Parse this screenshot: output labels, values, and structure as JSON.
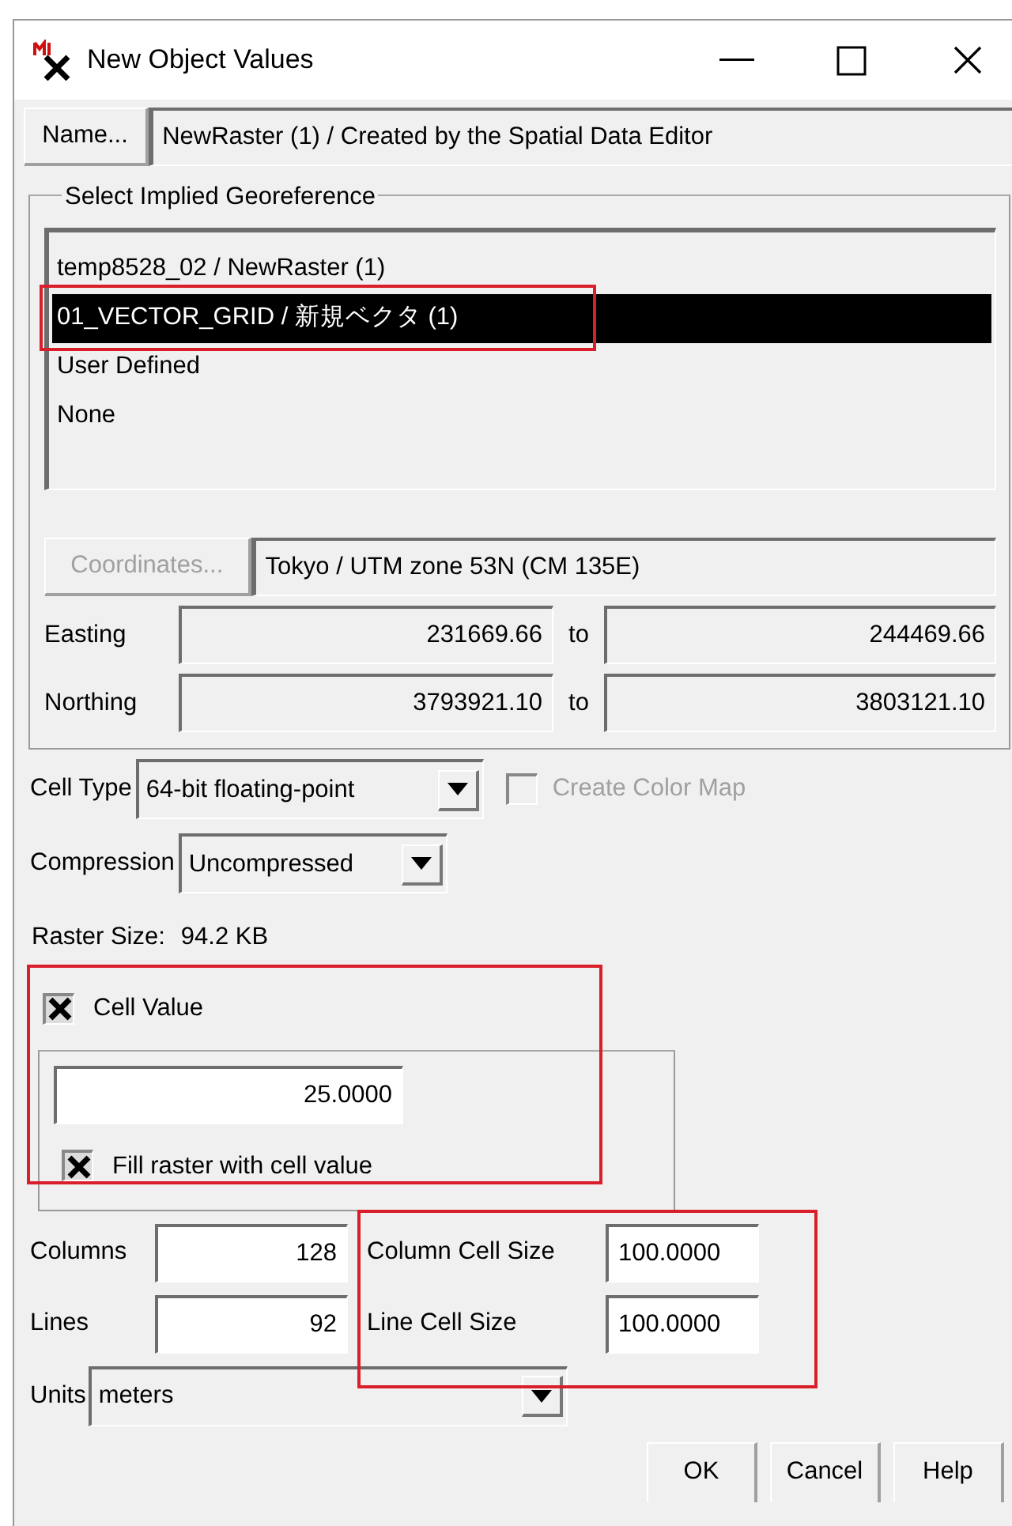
{
  "window": {
    "title": "New Object Values"
  },
  "name_button": {
    "label": "Name..."
  },
  "name_value": "NewRaster (1) / Created by the Spatial Data Editor",
  "georeference": {
    "legend": "Select Implied Georeference",
    "items": [
      {
        "label": "temp8528_02 / NewRaster (1)",
        "selected": false,
        "highlighted": false
      },
      {
        "label": "01_VECTOR_GRID / 新規ベクタ (1)",
        "selected": true,
        "highlighted": true
      },
      {
        "label": "User Defined",
        "selected": false,
        "highlighted": false
      },
      {
        "label": "None",
        "selected": false,
        "highlighted": false
      }
    ],
    "coordinates_button": {
      "label": "Coordinates...",
      "disabled": true
    },
    "coordinate_system": "Tokyo / UTM zone 53N (CM 135E)",
    "ranges": [
      {
        "label": "Easting",
        "from": "231669.66",
        "to_label": "to",
        "to": "244469.66"
      },
      {
        "label": "Northing",
        "from": "3793921.10",
        "to_label": "to",
        "to": "3803121.10"
      }
    ]
  },
  "cell_type": {
    "label": "Cell Type",
    "value": "64-bit floating-point"
  },
  "create_color_map": {
    "label": "Create Color Map",
    "checked": false,
    "disabled": true
  },
  "compression": {
    "label": "Compression",
    "value": "Uncompressed"
  },
  "raster_size": {
    "label": "Raster Size:",
    "value": "94.2 KB"
  },
  "cell_value": {
    "label": "Cell Value",
    "checked": true,
    "value": "25.0000",
    "highlighted": true,
    "fill": {
      "label": "Fill raster with cell value",
      "checked": true
    }
  },
  "columns": {
    "label": "Columns",
    "value": "128"
  },
  "lines": {
    "label": "Lines",
    "value": "92"
  },
  "cell_size": {
    "highlighted": true,
    "column": {
      "label": "Column Cell Size",
      "value": "100.0000"
    },
    "line": {
      "label": "Line Cell Size",
      "value": "100.0000"
    }
  },
  "units": {
    "label": "Units",
    "value": "meters"
  },
  "buttons": [
    "OK",
    "Cancel",
    "Help"
  ]
}
